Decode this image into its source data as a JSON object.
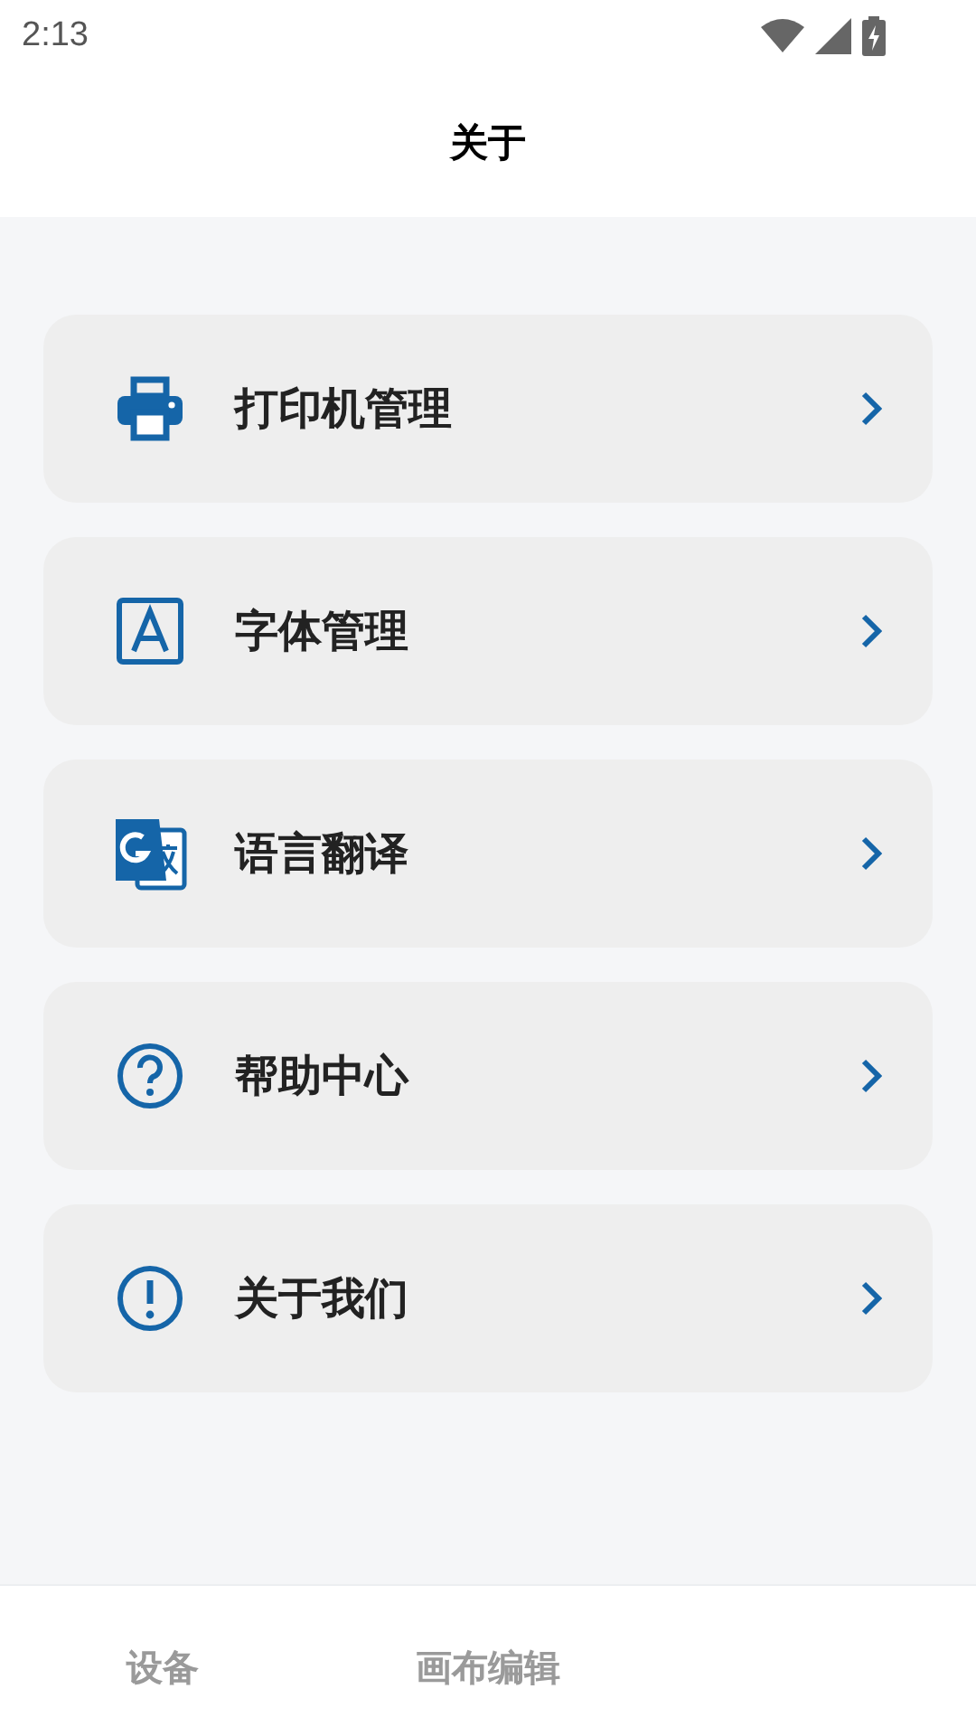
{
  "status_bar": {
    "time": "2:13"
  },
  "header": {
    "title": "关于"
  },
  "menu": [
    {
      "kind": "printer",
      "label": "打印机管理"
    },
    {
      "kind": "font",
      "label": "字体管理"
    },
    {
      "kind": "translate",
      "label": "语言翻译"
    },
    {
      "kind": "help",
      "label": "帮助中心"
    },
    {
      "kind": "info",
      "label": "关于我们"
    }
  ],
  "bottom_nav": [
    {
      "label": "设备"
    },
    {
      "label": "画布编辑"
    }
  ]
}
